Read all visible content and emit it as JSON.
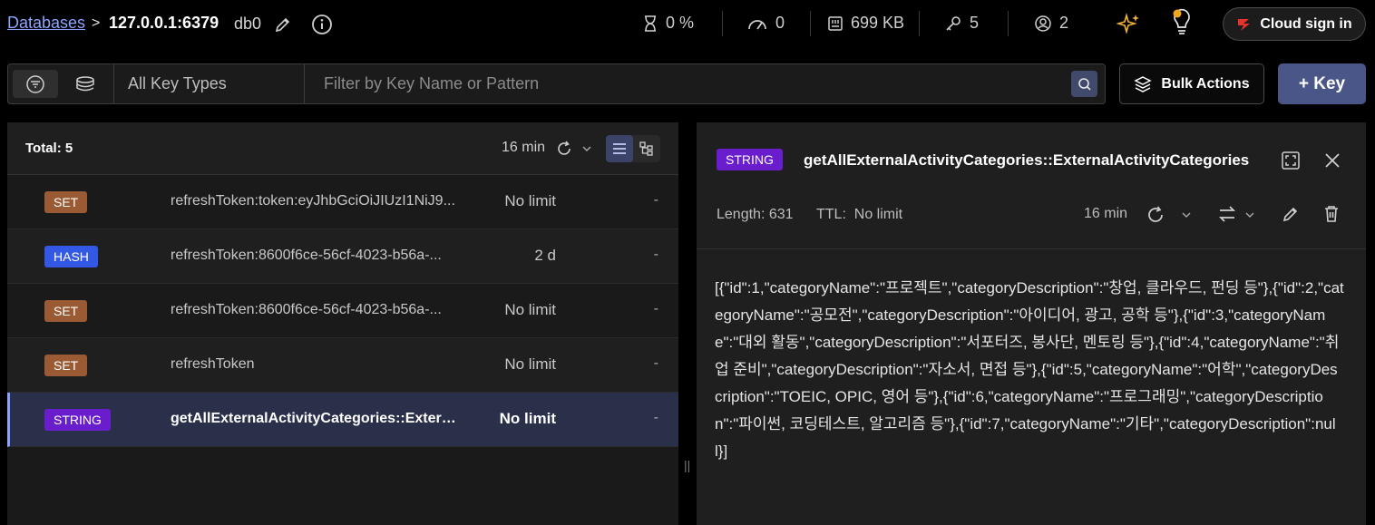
{
  "breadcrumb": {
    "databases": "Databases",
    "separator": ">",
    "host": "127.0.0.1:6379"
  },
  "db_label": "db0",
  "stats": {
    "cpu": "0 %",
    "ops": "0",
    "memory": "699 KB",
    "keys": "5",
    "clients": "2"
  },
  "cloud_button": "Cloud sign in",
  "filter": {
    "key_type": "All Key Types",
    "placeholder": "Filter by Key Name or Pattern",
    "value": ""
  },
  "bulk_actions": "Bulk Actions",
  "add_key": "+ Key",
  "list": {
    "total": "Total: 5",
    "refreshed": "16 min",
    "rows": [
      {
        "type": "SET",
        "name": "refreshToken:token:eyJhbGciOiJIUzI1NiJ9...",
        "ttl": "No limit",
        "size": "-"
      },
      {
        "type": "HASH",
        "name": "refreshToken:8600f6ce-56cf-4023-b56a-...",
        "ttl": "2 d",
        "size": "-"
      },
      {
        "type": "SET",
        "name": "refreshToken:8600f6ce-56cf-4023-b56a-...",
        "ttl": "No limit",
        "size": "-"
      },
      {
        "type": "SET",
        "name": "refreshToken",
        "ttl": "No limit",
        "size": "-"
      },
      {
        "type": "STRING",
        "name": "getAllExternalActivityCategories::ExternalActivityCategories",
        "ttl": "No limit",
        "size": "-"
      }
    ]
  },
  "type_colors": {
    "SET": "#9a5b34",
    "HASH": "#3358e6",
    "STRING": "#6a1dcc"
  },
  "details": {
    "type": "STRING",
    "key": "getAllExternalActivityCategories::ExternalActivityCategories",
    "length": "Length: 631",
    "ttl_label": "TTL:",
    "ttl_value": "No limit",
    "refreshed": "16 min",
    "value": "[{\"id\":1,\"categoryName\":\"프로젝트\",\"categoryDescription\":\"창업, 클라우드, 펀딩 등\"},{\"id\":2,\"categoryName\":\"공모전\",\"categoryDescription\":\"아이디어, 광고, 공학 등\"},{\"id\":3,\"categoryName\":\"대외 활동\",\"categoryDescription\":\"서포터즈, 봉사단, 멘토링 등\"},{\"id\":4,\"categoryName\":\"취업 준비\",\"categoryDescription\":\"자소서, 면접 등\"},{\"id\":5,\"categoryName\":\"어학\",\"categoryDescription\":\"TOEIC, OPIC, 영어 등\"},{\"id\":6,\"categoryName\":\"프로그래밍\",\"categoryDescription\":\"파이썬, 코딩테스트, 알고리즘 등\"},{\"id\":7,\"categoryName\":\"기타\",\"categoryDescription\":null}]"
  }
}
